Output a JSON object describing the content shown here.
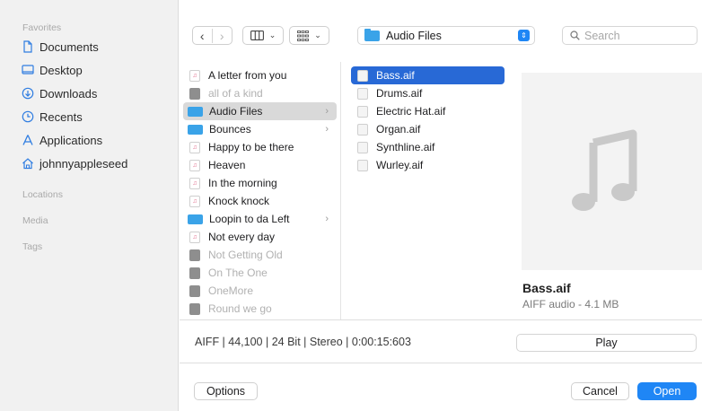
{
  "sidebar": {
    "favorites_label": "Favorites",
    "items": [
      {
        "label": "Documents",
        "icon": "document-icon"
      },
      {
        "label": "Desktop",
        "icon": "desktop-icon"
      },
      {
        "label": "Downloads",
        "icon": "downloads-icon"
      },
      {
        "label": "Recents",
        "icon": "clock-icon"
      },
      {
        "label": "Applications",
        "icon": "applications-icon"
      },
      {
        "label": "johnnyappleseed",
        "icon": "home-icon"
      }
    ],
    "locations_label": "Locations",
    "media_label": "Media",
    "tags_label": "Tags"
  },
  "toolbar": {
    "back_icon": "chevron-left-icon",
    "forward_icon": "chevron-right-icon",
    "view_icon": "column-view-icon",
    "group_icon": "grid-view-icon",
    "path_label": "Audio Files",
    "search_placeholder": "Search"
  },
  "column1": [
    {
      "label": "A letter from you",
      "type": "note",
      "dim": false
    },
    {
      "label": "all of a kind",
      "type": "gray",
      "dim": true
    },
    {
      "label": "Audio Files",
      "type": "folder",
      "selected": "gray",
      "chevron": "›"
    },
    {
      "label": "Bounces",
      "type": "folder",
      "chevron": "›"
    },
    {
      "label": "Happy to be there",
      "type": "note"
    },
    {
      "label": "Heaven",
      "type": "note"
    },
    {
      "label": "In the morning",
      "type": "note"
    },
    {
      "label": "Knock knock",
      "type": "note"
    },
    {
      "label": "Loopin to da Left",
      "type": "folder",
      "chevron": "›"
    },
    {
      "label": "Not every day",
      "type": "note"
    },
    {
      "label": "Not Getting Old",
      "type": "gray",
      "dim": true
    },
    {
      "label": "On The One",
      "type": "gray",
      "dim": true
    },
    {
      "label": "OneMore",
      "type": "gray",
      "dim": true
    },
    {
      "label": "Round we go",
      "type": "gray",
      "dim": true
    }
  ],
  "column2": [
    {
      "label": "Bass.aif",
      "selected": "blue"
    },
    {
      "label": "Drums.aif"
    },
    {
      "label": "Electric Hat.aif"
    },
    {
      "label": "Organ.aif"
    },
    {
      "label": "Synthline.aif"
    },
    {
      "label": "Wurley.aif"
    }
  ],
  "preview": {
    "name": "Bass.aif",
    "info": "AIFF audio - 4.1 MB",
    "icon": "music-note-icon"
  },
  "status_text": "AIFF  |  44,100  |  24 Bit  |  Stereo  |  0:00:15:603",
  "play_label": "Play",
  "buttons": {
    "options": "Options",
    "cancel": "Cancel",
    "open": "Open"
  },
  "colors": {
    "accent": "#1f86f5",
    "selection": "#2869d6",
    "folder": "#3aa3e8"
  }
}
